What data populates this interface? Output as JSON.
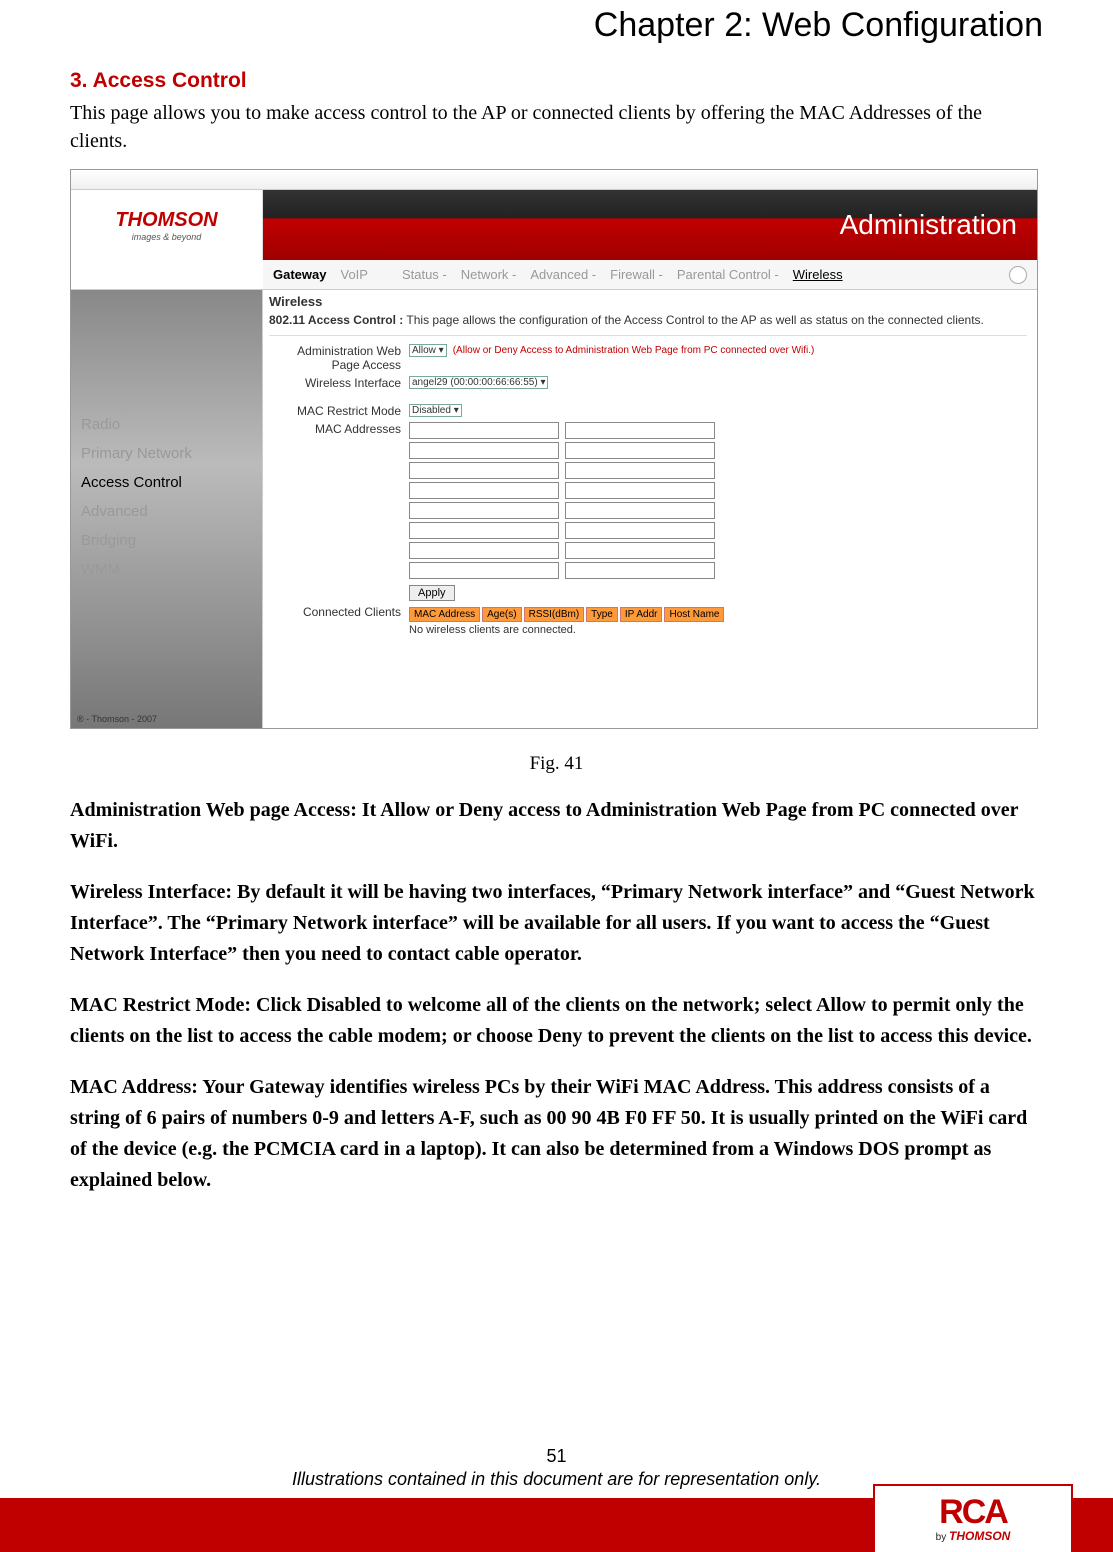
{
  "chapter_title": "Chapter 2: Web Configuration",
  "section_title": "3. Access Control",
  "intro": "This page allows you to make access control to the AP or connected clients by offering the MAC Addresses of the clients.",
  "screenshot": {
    "logo_main": "THOMSON",
    "logo_sub": "images & beyond",
    "admin_title": "Administration",
    "tabs": {
      "gateway": "Gateway",
      "voip": "VoIP",
      "status": "Status -",
      "network": "Network -",
      "advanced": "Advanced -",
      "firewall": "Firewall -",
      "parental": "Parental Control -",
      "wireless": "Wireless"
    },
    "sidebar": {
      "radio": "Radio",
      "primary": "Primary Network",
      "access": "Access Control",
      "advanced": "Advanced",
      "bridging": "Bridging",
      "wmm": "WMM"
    },
    "copyright": "® - Thomson - 2007",
    "main": {
      "wireless_title": "Wireless",
      "desc_label": "802.11 Access Control :",
      "desc_text": "This page allows the configuration of the Access Control to the AP as well as status on the connected clients.",
      "admin_label": "Administration Web Page Access",
      "admin_value": "Allow",
      "admin_hint": "(Allow or Deny Access to Administration Web Page from PC connected over Wifi.)",
      "iface_label": "Wireless Interface",
      "iface_value": "angel29 (00:00:00:66:66:55)",
      "restrict_label": "MAC Restrict Mode",
      "restrict_value": "Disabled",
      "mac_label": "MAC Addresses",
      "apply": "Apply",
      "clients_label": "Connected Clients",
      "table_headers": [
        "MAC Address",
        "Age(s)",
        "RSSI(dBm)",
        "Type",
        "IP Addr",
        "Host Name"
      ],
      "no_clients": "No wireless clients are connected."
    }
  },
  "fig_caption": "Fig. 41",
  "para1": "Administration Web page Access: It Allow or Deny access to Administration Web Page from PC connected over WiFi.",
  "para2": "Wireless Interface: By default it will be having two interfaces, “Primary Network interface” and “Guest Network Interface”. The “Primary Network interface” will be available for all users. If you want to access the “Guest Network Interface” then you need to contact cable operator.",
  "para3": "MAC Restrict Mode: Click Disabled to welcome all of the clients on the network; select Allow to permit only the clients on the list to access the cable modem; or choose Deny to prevent the clients on the list to access this device.",
  "para4": "MAC Address: Your Gateway identifies wireless PCs by their WiFi MAC Address. This address consists of a string of 6 pairs of numbers 0-9 and letters A-F, such as 00 90 4B F0 FF 50. It is usually printed on the WiFi card of the device (e.g. the PCMCIA card in a laptop). It can also be determined from a Windows DOS prompt as explained below.",
  "footer": {
    "page_num": "51",
    "disclaimer": "Illustrations contained in this document are for representation only."
  },
  "rca": {
    "logo": "RCA",
    "by": "by",
    "brand": "THOMSON"
  }
}
